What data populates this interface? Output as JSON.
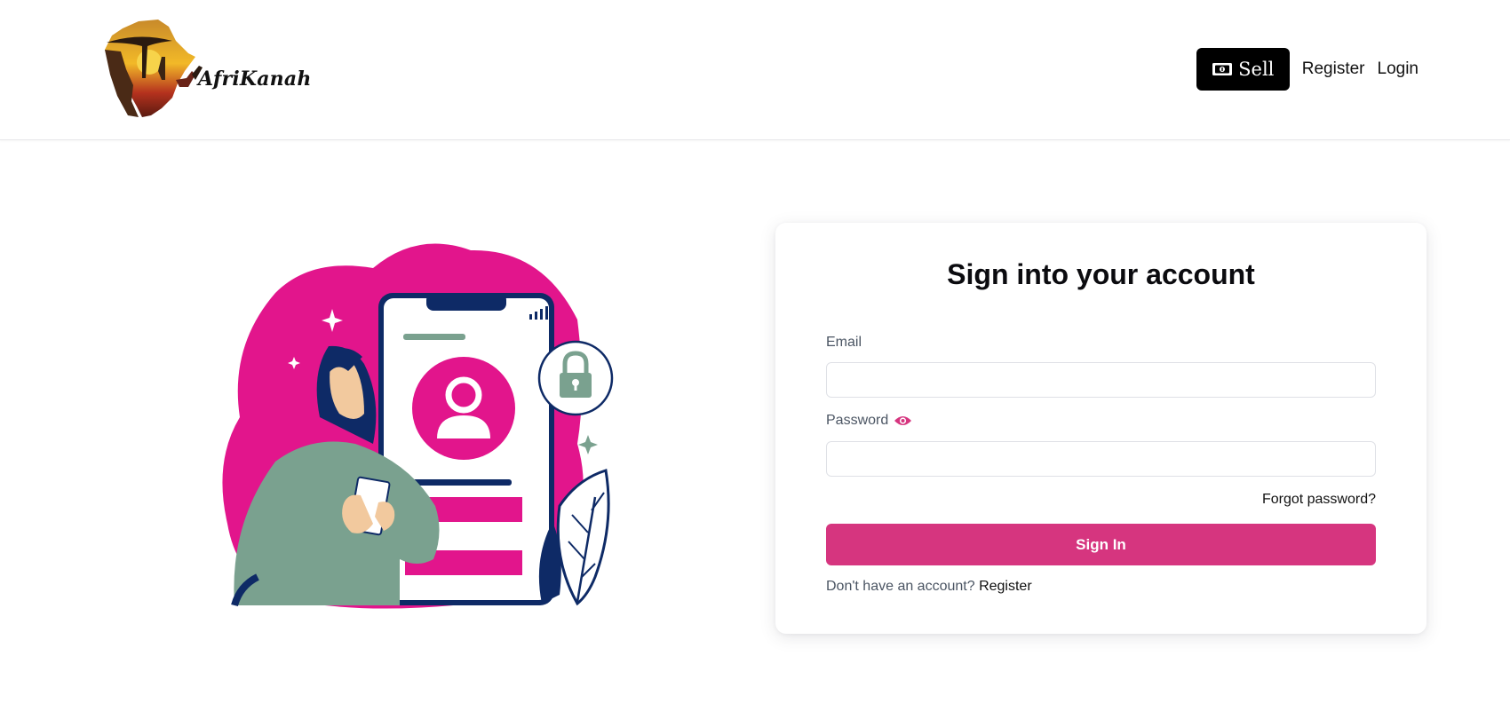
{
  "header": {
    "brand_name": "AfriKanah",
    "sell_label": "Sell",
    "register_label": "Register",
    "login_label": "Login"
  },
  "login_card": {
    "title": "Sign into your account",
    "email_label": "Email",
    "email_value": "",
    "password_label": "Password",
    "password_value": "",
    "forgot_label": "Forgot password?",
    "signin_label": "Sign In",
    "no_account_text": "Don't have an account?",
    "register_link": "Register"
  },
  "colors": {
    "accent": "#d6357f",
    "illustration_pink": "#e2158c",
    "illustration_navy": "#0e2a66",
    "illustration_green": "#7aa18f"
  },
  "icons": [
    "money-icon",
    "eye-icon",
    "user-icon",
    "lock-icon"
  ]
}
